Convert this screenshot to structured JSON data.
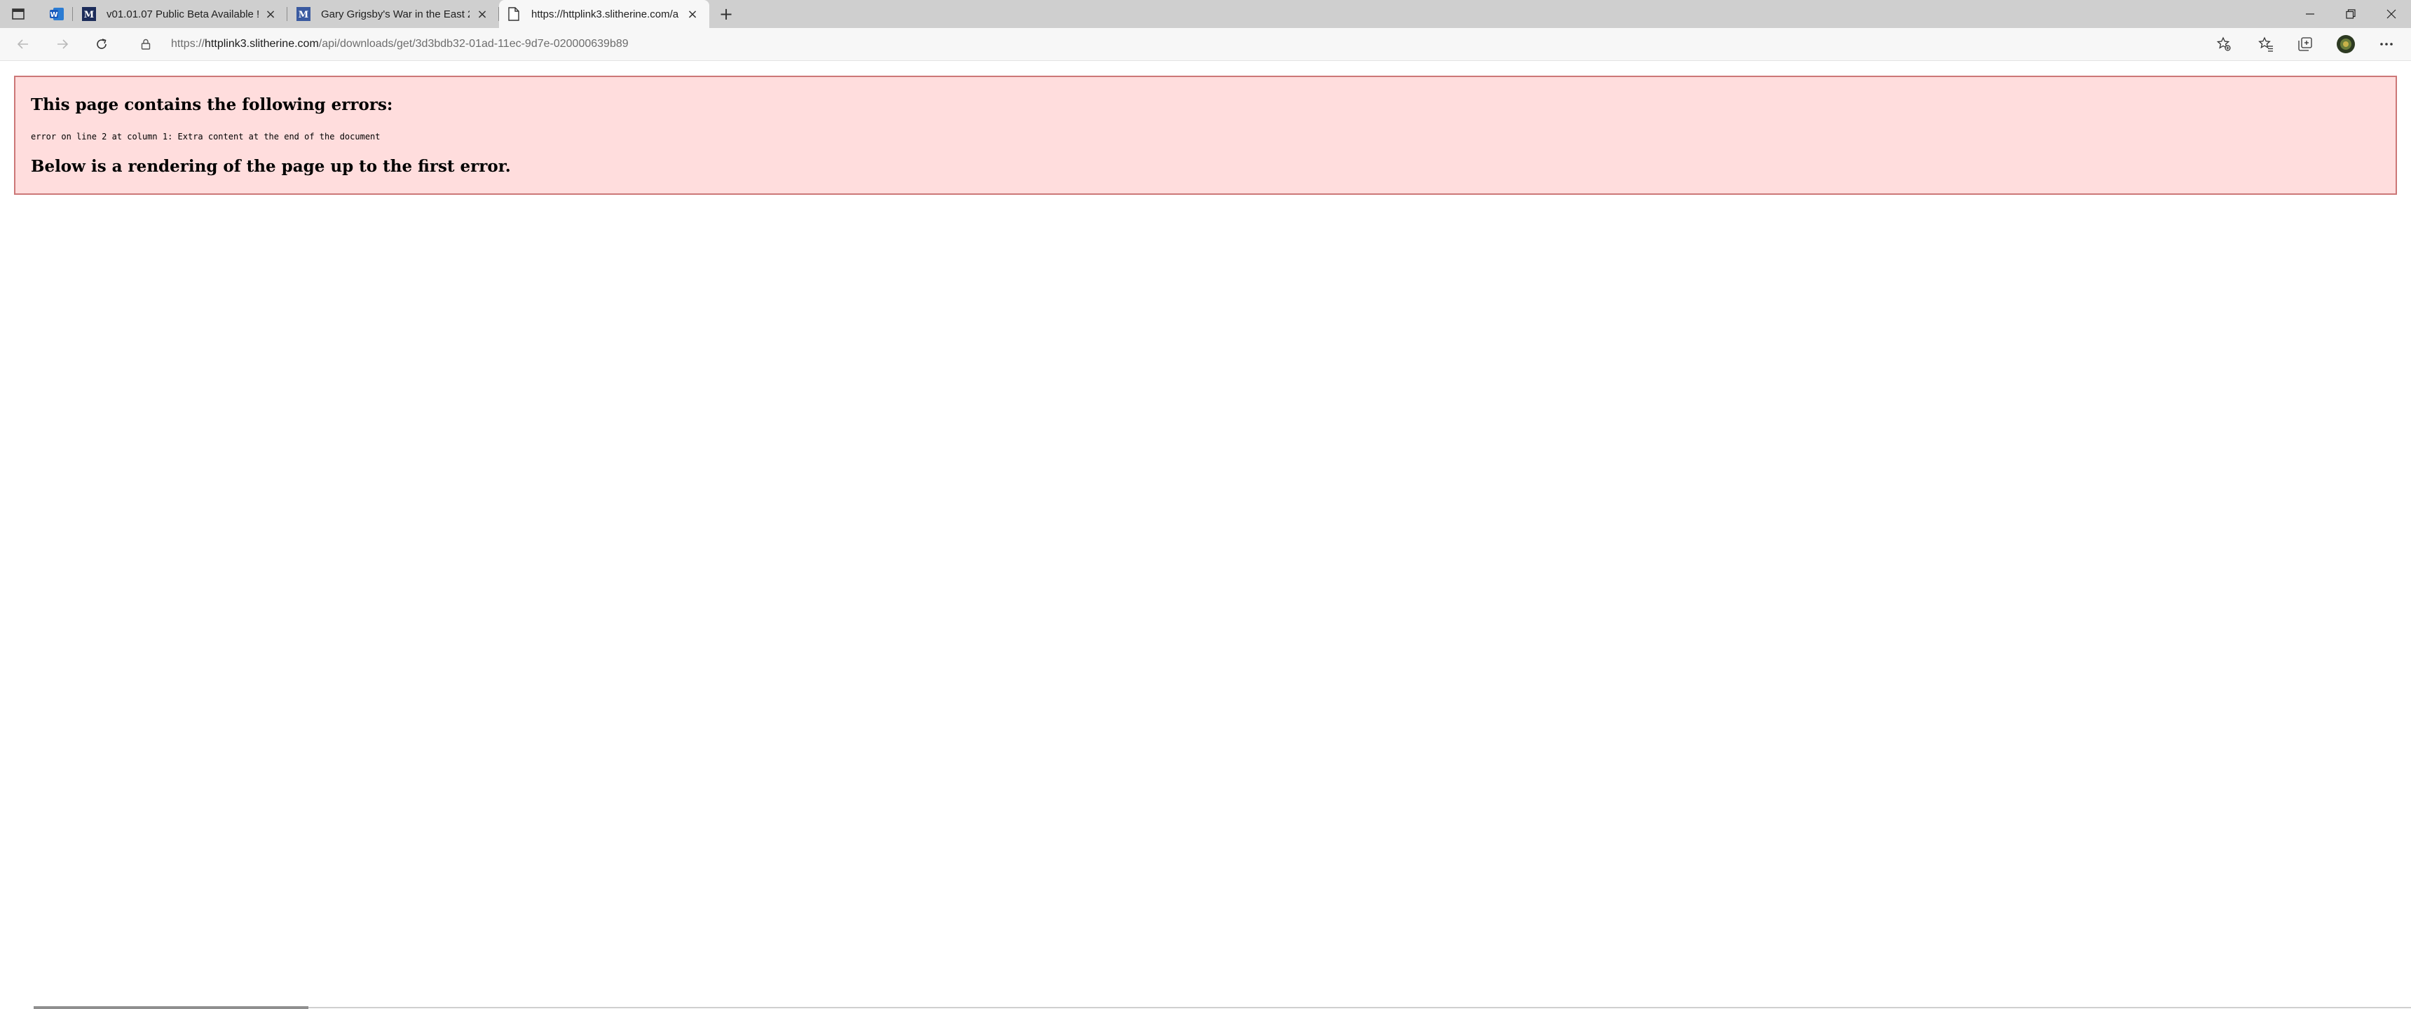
{
  "browser": {
    "tabs": [
      {
        "title": "",
        "icon": "word-app-icon",
        "active": false
      },
      {
        "title": "v01.01.07 Public Beta Available !",
        "icon": "slitherine-site-icon",
        "active": false
      },
      {
        "title": "Gary Grigsby's War in the East 2",
        "icon": "slitherine-site-icon",
        "active": false
      },
      {
        "title": "https://httplink3.slitherine.com/a",
        "icon": "page-icon",
        "active": true
      }
    ],
    "address": {
      "scheme": "https://",
      "host": "httplink3.slitherine.com",
      "path": "/api/downloads/get/3d3bdb32-01ad-11ec-9d7e-020000639b89"
    },
    "colors": {
      "tabstrip": "#cfcfcf",
      "toolbar": "#f7f7f7"
    }
  },
  "error_page": {
    "heading": "This page contains the following errors:",
    "message": "error on line 2 at column 1: Extra content at the end of the document",
    "rendering_note": "Below is a rendering of the page up to the first error.",
    "colors": {
      "background": "#ffdddd",
      "border": "#cc7777"
    }
  }
}
